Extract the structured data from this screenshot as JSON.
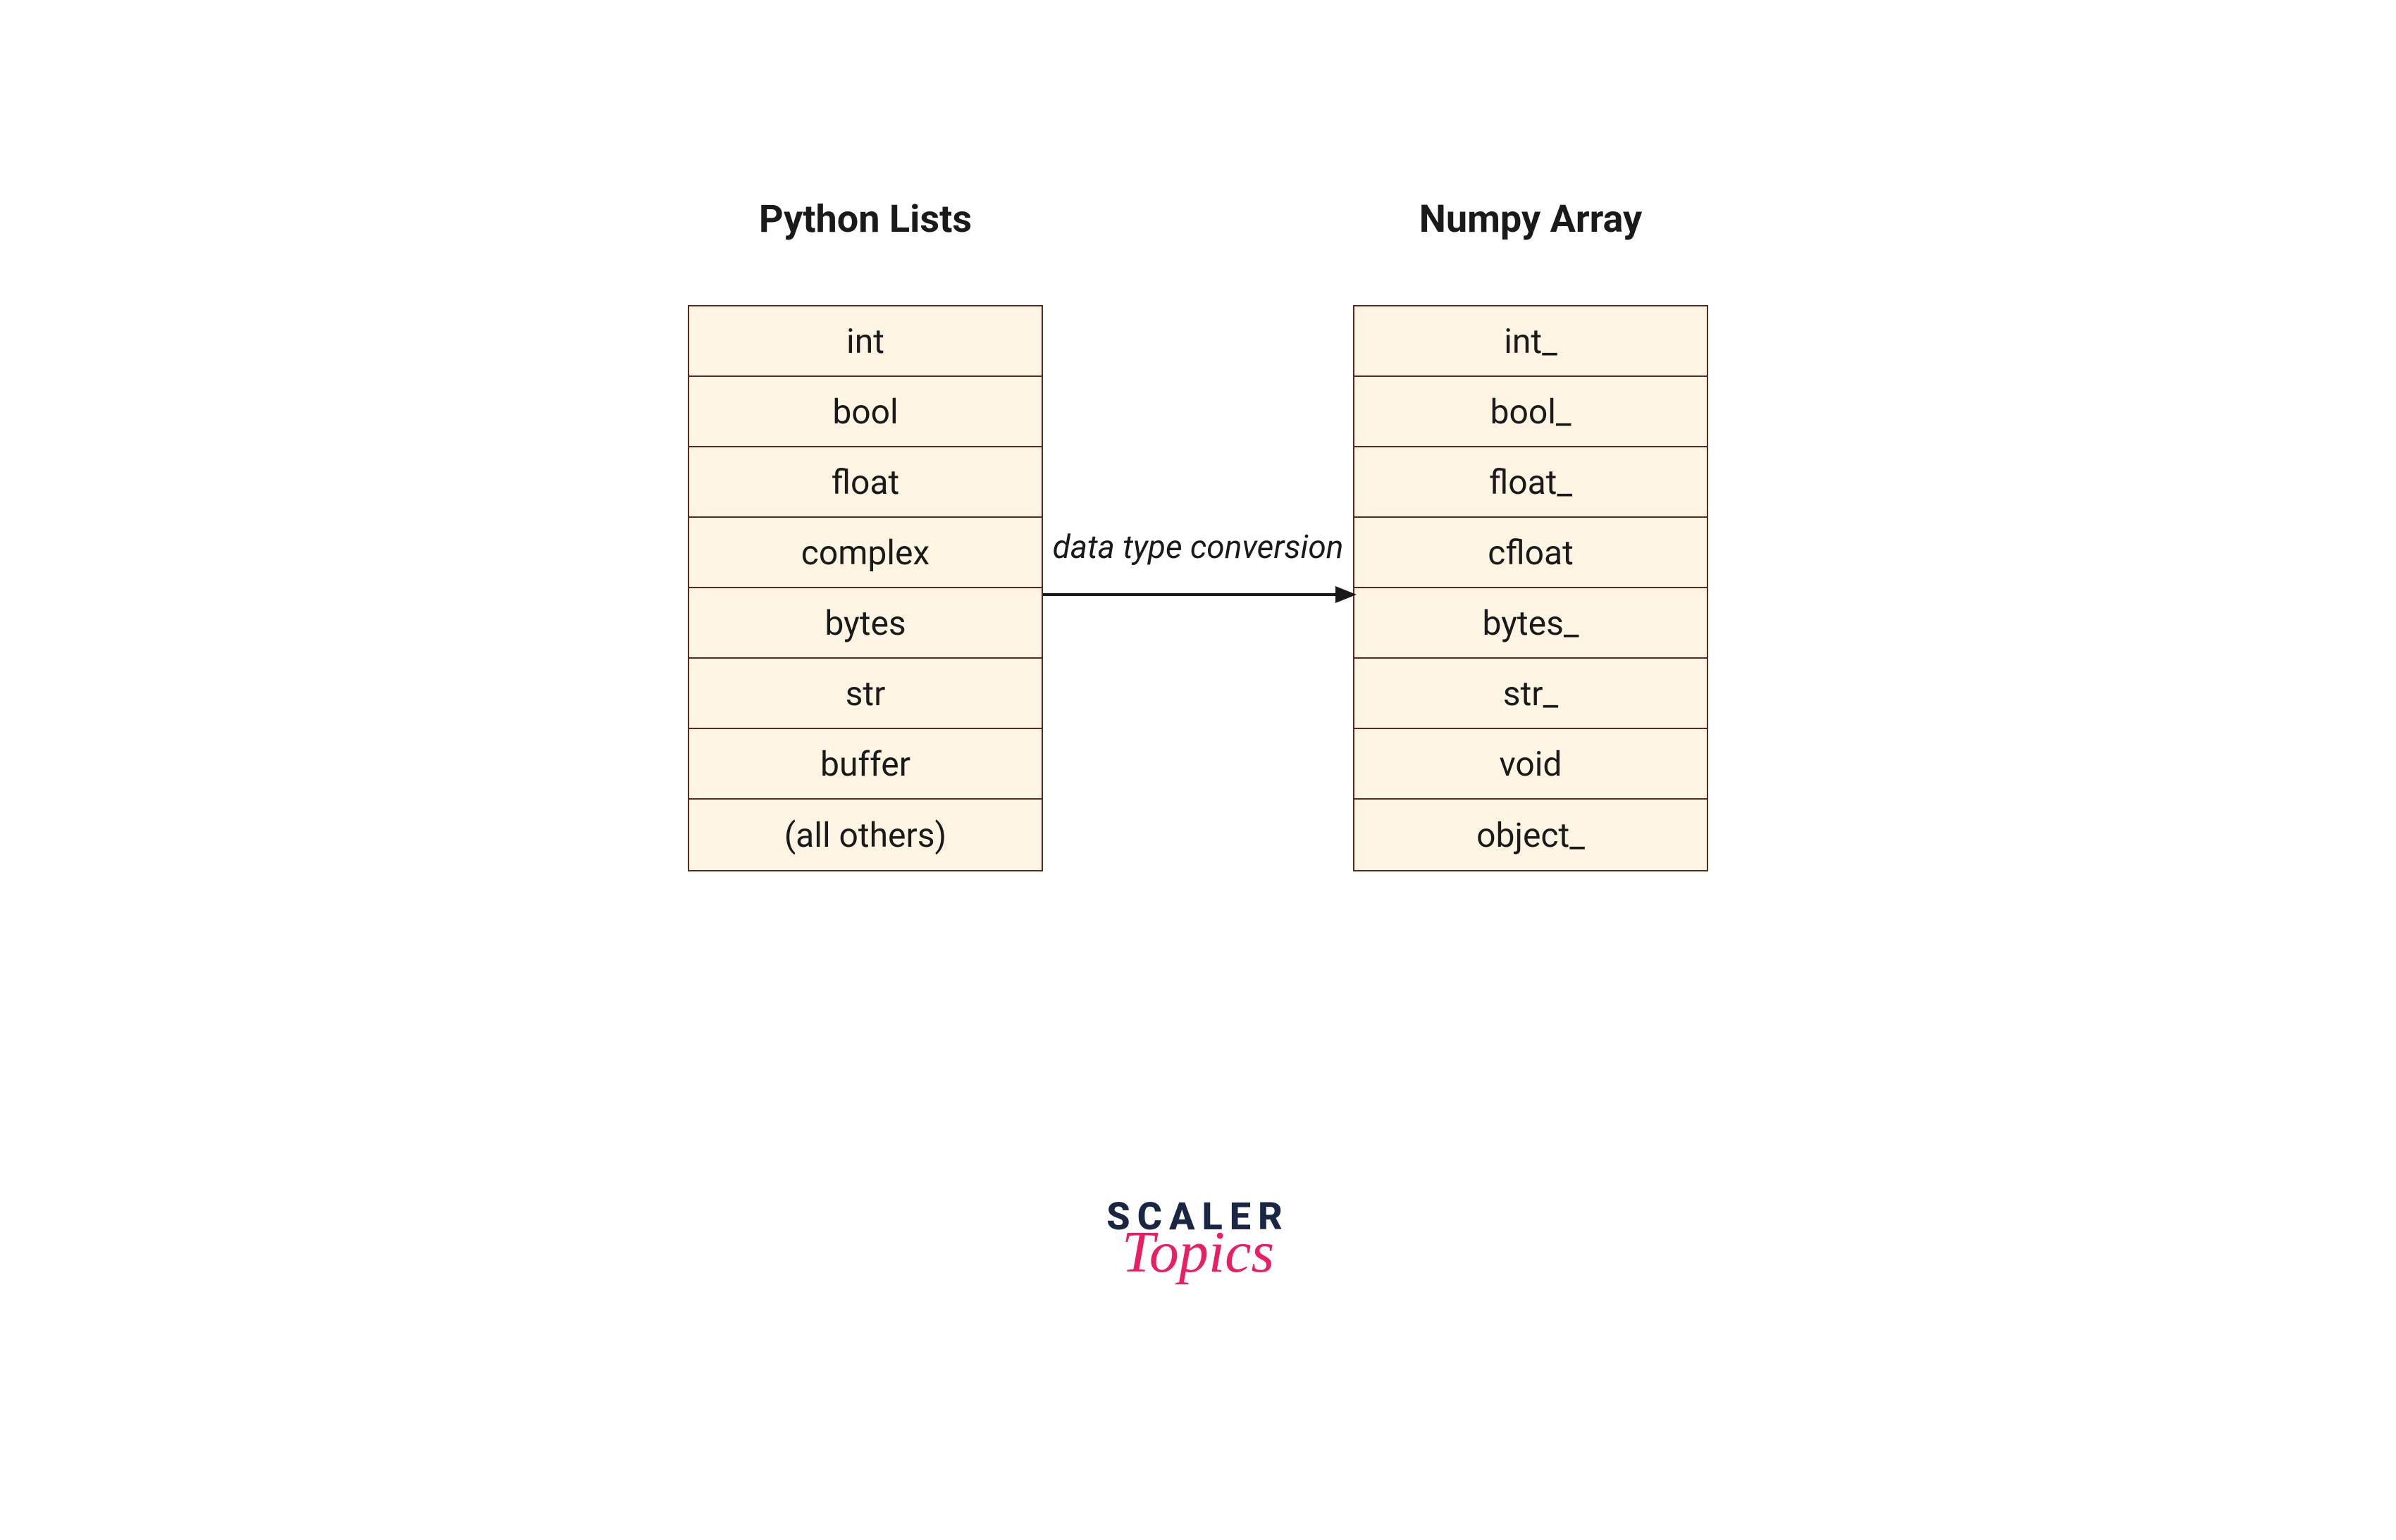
{
  "left_column": {
    "title": "Python Lists",
    "items": [
      "int",
      "bool",
      "float",
      "complex",
      "bytes",
      "str",
      "buffer",
      "(all others)"
    ]
  },
  "right_column": {
    "title": "Numpy Array",
    "items": [
      "int_",
      "bool_",
      "float_",
      "cfloat",
      "bytes_",
      "str_",
      "void",
      "object_"
    ]
  },
  "arrow_label": "data type conversion",
  "logo": {
    "line1": "SCALER",
    "line2": "Topics"
  }
}
